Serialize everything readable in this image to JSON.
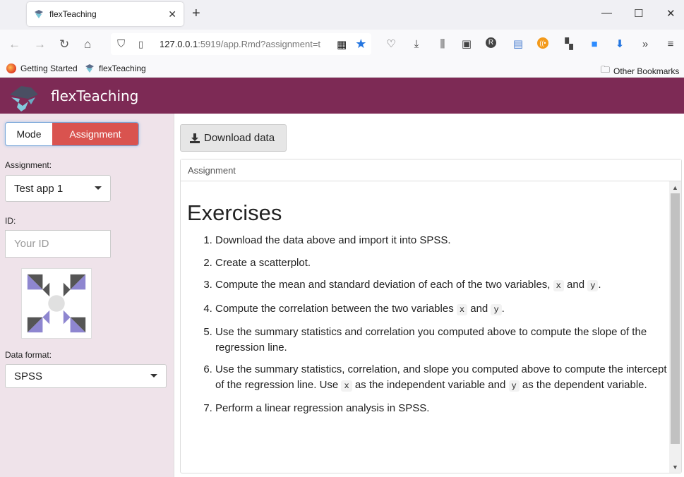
{
  "browser": {
    "tab_title": "flexTeaching",
    "url_main": "127.0.0.1",
    "url_rest": ":5919/app.Rmd?assignment=t",
    "bookmarks": [
      {
        "label": "Getting Started"
      },
      {
        "label": "flexTeaching"
      }
    ],
    "other_bookmarks": "Other Bookmarks"
  },
  "app": {
    "title": "flexTeaching",
    "brand_color": "#7d2a55"
  },
  "sidebar": {
    "mode_label": "Mode",
    "assignment_toggle_label": "Assignment",
    "assignment_label": "Assignment:",
    "assignment_value": "Test app 1",
    "id_label": "ID:",
    "id_placeholder": "Your ID",
    "data_format_label": "Data format:",
    "data_format_value": "SPSS"
  },
  "main": {
    "download_label": "Download data",
    "panel_title": "Assignment",
    "heading": "Exercises",
    "exercises": [
      {
        "text": "Download the data above and import it into SPSS."
      },
      {
        "text": "Create a scatterplot."
      },
      {
        "t1": "Compute the mean and standard deviation of each of the two variables,",
        "c1": "x",
        "t2": "and",
        "c2": "y",
        "t3": "."
      },
      {
        "t1": "Compute the correlation between the two variables",
        "c1": "x",
        "t2": "and",
        "c2": "y",
        "t3": "."
      },
      {
        "text": "Use the summary statistics and correlation you computed above to compute the slope of the regression line."
      },
      {
        "t1": "Use the summary statistics, correlation, and slope you computed above to compute the intercept of the regression line. Use",
        "c1": "x",
        "t2": "as the independent variable and",
        "c2": "y",
        "t3": "as the dependent variable."
      },
      {
        "text": "Perform a linear regression analysis in SPSS."
      }
    ]
  }
}
